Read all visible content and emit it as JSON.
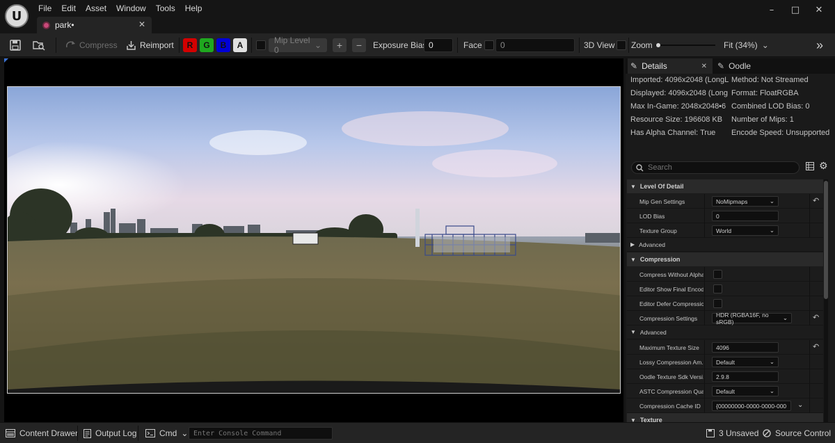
{
  "app": {
    "menu": [
      "File",
      "Edit",
      "Asset",
      "Window",
      "Tools",
      "Help"
    ],
    "tab": {
      "label": "park•"
    }
  },
  "toolbar": {
    "compress_label": "Compress",
    "reimport_label": "Reimport",
    "channels": [
      "R",
      "G",
      "B",
      "A"
    ],
    "channel_colors": {
      "R": "#d40000",
      "G": "#1fa81f",
      "B": "#0000d8",
      "A": "#e0e0e0"
    },
    "mip_level": "Mip Level 0",
    "exposure_label": "Exposure Bias",
    "exposure_value": "0",
    "face_label": "Face",
    "face_value": "0",
    "view3d_label": "3D View",
    "zoom_label": "Zoom",
    "fit_label": "Fit (34%)"
  },
  "details": {
    "tabs": [
      "Details",
      "Oodle"
    ],
    "info_left": [
      "Imported: 4096x2048 (LongL",
      "Displayed: 4096x2048 (Long",
      "Max In-Game: 2048x2048•6",
      "Resource Size: 196608 KB",
      "Has Alpha Channel: True"
    ],
    "info_right": [
      "Method: Not Streamed",
      "Format: FloatRGBA",
      "Combined LOD Bias: 0",
      "Number of Mips: 1",
      "Encode Speed: Unsupported"
    ],
    "search_placeholder": "Search",
    "categories": {
      "lod": "Level Of Detail",
      "lod_advanced": "Advanced",
      "compression": "Compression",
      "comp_advanced": "Advanced",
      "texture": "Texture"
    },
    "rows": {
      "mip_gen": {
        "label": "Mip Gen Settings",
        "value": "NoMipmaps"
      },
      "lod_bias": {
        "label": "LOD Bias",
        "value": "0"
      },
      "tex_group": {
        "label": "Texture Group",
        "value": "World"
      },
      "comp_no_alpha": {
        "label": "Compress Without Alpha"
      },
      "editor_show": {
        "label": "Editor Show Final Encode"
      },
      "editor_defer": {
        "label": "Editor Defer Compression"
      },
      "comp_settings": {
        "label": "Compression Settings",
        "value": "HDR (RGBA16F, no sRGB)"
      },
      "max_tex": {
        "label": "Maximum Texture Size",
        "value": "4096"
      },
      "lossy": {
        "label": "Lossy Compression Am...",
        "value": "Default"
      },
      "oodle_sdk": {
        "label": "Oodle Texture Sdk Versi...",
        "value": "2.9.8"
      },
      "astc": {
        "label": "ASTC Compression Qual...",
        "value": "Default"
      },
      "cache_id": {
        "label": "Compression Cache ID",
        "value": "{00000000-0000-0000-000"
      }
    }
  },
  "statusbar": {
    "content_drawer": "Content Drawer",
    "output_log": "Output Log",
    "cmd": "Cmd",
    "console_placeholder": "Enter Console Command",
    "unsaved": "3 Unsaved",
    "source_control": "Source Control"
  }
}
